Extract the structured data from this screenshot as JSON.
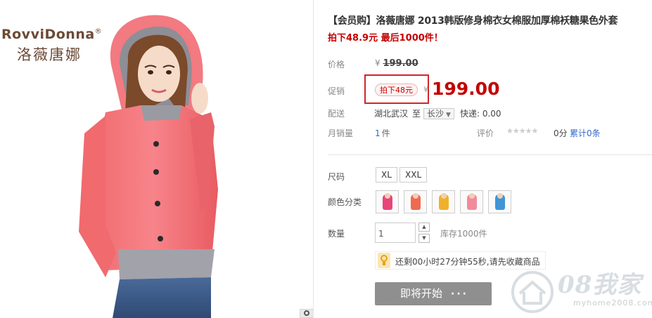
{
  "brand": {
    "name_en": "RovviDonna",
    "reg": "®",
    "name_cn": "洛薇唐娜"
  },
  "product": {
    "title": "【会员购】洛薇唐娜 2013韩版修身棉衣女棉服加厚棉袄糖果色外套",
    "subtitle": "拍下48.9元 最后1000件！"
  },
  "price": {
    "label": "价格",
    "yen": "¥",
    "original": "199.00"
  },
  "promo": {
    "label": "促销",
    "tag": "拍下48元",
    "yen": "¥",
    "price": "199.00"
  },
  "shipping": {
    "label": "配送",
    "from": "湖北武汉",
    "to_label": "至",
    "to": "长沙",
    "fee_label": "快递: 0.00"
  },
  "sales": {
    "label": "月销量",
    "count": "1",
    "unit": "件",
    "rating_label": "评价",
    "stars": "★★★★★",
    "score": "0分",
    "reviews": "累计0条"
  },
  "size": {
    "label": "尺码",
    "options": [
      "XL",
      "XXL"
    ]
  },
  "color": {
    "label": "颜色分类",
    "swatches": [
      "#e8457a",
      "#ee6a50",
      "#f0b12a",
      "#f28a9a",
      "#3f95d6"
    ]
  },
  "quantity": {
    "label": "数量",
    "value": "1",
    "up": "▲",
    "down": "▼",
    "stock": "库存1000件"
  },
  "tip": {
    "text": "还剩00小时27分钟55秒,请先收藏商品"
  },
  "buy": {
    "label": "即将开始",
    "dots": "···"
  },
  "watermark": {
    "text": "08我家",
    "url": "myhome2008.com"
  }
}
